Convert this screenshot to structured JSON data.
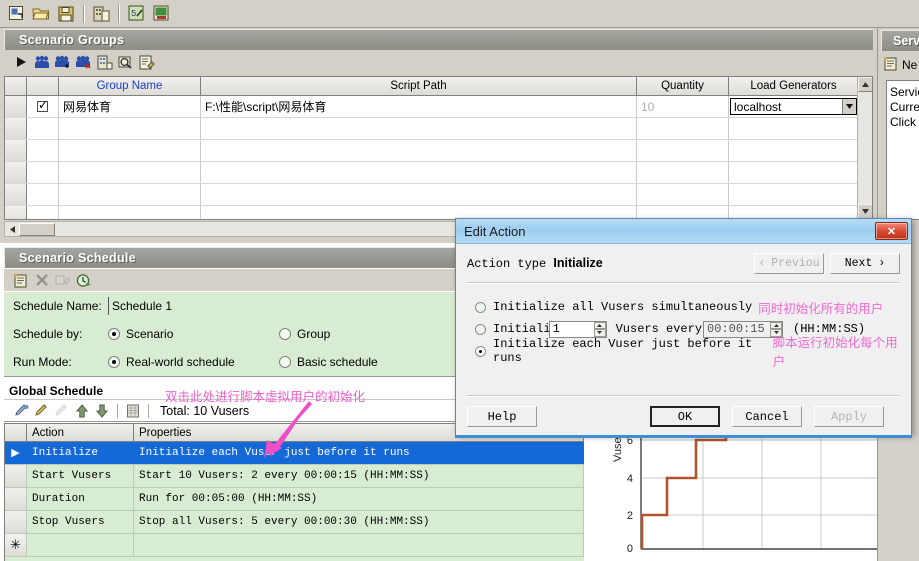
{
  "toolbar": {
    "buttons": [
      {
        "name": "open-scenario-icon",
        "glyph": "⬚"
      },
      {
        "name": "open-folder-icon",
        "glyph": "📂"
      },
      {
        "name": "save-icon",
        "glyph": "💾"
      },
      {
        "name": "report-icon",
        "glyph": "📊"
      },
      {
        "name": "run-script-icon",
        "glyph": "📝"
      },
      {
        "name": "results-icon",
        "glyph": "🖼"
      }
    ]
  },
  "scenario_groups": {
    "title": "Scenario Groups",
    "toolbar": [
      {
        "name": "start-scenario-icon",
        "glyph": "▶"
      },
      {
        "name": "vuser-group-icon",
        "glyph": "👥"
      },
      {
        "name": "add-vusers-icon",
        "glyph": "👥"
      },
      {
        "name": "remove-vusers-icon",
        "glyph": "👥"
      },
      {
        "name": "group-details-icon",
        "glyph": "🏢"
      },
      {
        "name": "view-script-icon",
        "glyph": "🔍"
      },
      {
        "name": "edit-script-icon",
        "glyph": "📄"
      }
    ],
    "columns": [
      "",
      "",
      "Group Name",
      "Script Path",
      "Quantity",
      "Load Generators"
    ],
    "rows": [
      {
        "selected": true,
        "enabled": true,
        "group_name": "网易体育",
        "script_path": "F:\\性能\\script\\网易体育",
        "quantity": "10",
        "load_generator": "localhost"
      }
    ]
  },
  "scenario_schedule": {
    "title": "Scenario Schedule",
    "toolbar": [
      {
        "name": "new-schedule-icon",
        "glyph": "📜"
      },
      {
        "name": "delete-schedule-icon",
        "glyph": "✕"
      },
      {
        "name": "rename-schedule-icon",
        "glyph": "✎"
      },
      {
        "name": "schedule-clock-icon",
        "glyph": "🕑"
      }
    ],
    "schedule_name_label": "Schedule Name:",
    "schedule_name_value": "Schedule 1",
    "schedule_by_label": "Schedule by:",
    "schedule_by_options": [
      {
        "label": "Scenario",
        "selected": true
      },
      {
        "label": "Group",
        "selected": false
      }
    ],
    "run_mode_label": "Run Mode:",
    "run_mode_options": [
      {
        "label": "Real-world schedule",
        "selected": true
      },
      {
        "label": "Basic schedule",
        "selected": false
      }
    ]
  },
  "global_schedule": {
    "title": "Global Schedule",
    "toolbar": [
      {
        "name": "add-action-icon",
        "glyph": "✏"
      },
      {
        "name": "edit-action-icon",
        "glyph": "✏"
      },
      {
        "name": "delete-action-icon",
        "glyph": "✏"
      },
      {
        "name": "move-up-icon",
        "glyph": "⬆"
      },
      {
        "name": "move-down-icon",
        "glyph": "⬇"
      },
      {
        "name": "grid-view-icon",
        "glyph": "☰"
      }
    ],
    "total_label": "Total: 10 Vusers",
    "columns": [
      "",
      "Action",
      "Properties"
    ],
    "rows": [
      {
        "selected": true,
        "marker": "▶",
        "action": "Initialize",
        "properties": "Initialize each Vuser just before it runs"
      },
      {
        "selected": false,
        "marker": "",
        "action": "Start  Vusers",
        "properties": "Start 10 Vusers: 2 every 00:00:15 (HH:MM:SS)"
      },
      {
        "selected": false,
        "marker": "",
        "action": "Duration",
        "properties": "Run for 00:05:00 (HH:MM:SS)"
      },
      {
        "selected": false,
        "marker": "",
        "action": "Stop Vusers",
        "properties": "Stop all Vusers: 5 every 00:00:30 (HH:MM:SS)"
      },
      {
        "selected": false,
        "marker": "✳",
        "action": "",
        "properties": ""
      }
    ]
  },
  "right_panel": {
    "title": "Serv",
    "new_label": "Ne",
    "lines": [
      "Servic",
      "Curre",
      "Click"
    ]
  },
  "edit_action_dialog": {
    "title": "Edit Action",
    "close_glyph": "✕",
    "action_type_label": "Action type",
    "action_type_value": "Initialize",
    "previous_label": "Previou",
    "previous_chevron": "‹",
    "next_label": "Next",
    "next_chevron": "›",
    "options": [
      {
        "id": "init-all-simultaneously",
        "selected": false,
        "label": "Initialize all Vusers simultaneously",
        "annotation": "同时初始化所有的用户"
      },
      {
        "id": "init-batch",
        "selected": false,
        "label_prefix": "Initiali",
        "count_value": "1",
        "label_middle": "Vusers every",
        "interval_value": "00:00:15",
        "format_hint": "(HH:MM:SS)"
      },
      {
        "id": "init-each-before-run",
        "selected": true,
        "label": "Initialize each Vuser just before it runs",
        "annotation": "脚本运行初始化每个用户"
      }
    ],
    "buttons": {
      "help": "Help",
      "ok": "OK",
      "cancel": "Cancel",
      "apply": "Apply"
    }
  },
  "annotations": [
    {
      "name": "double-click-hint",
      "text": "双击此处进行脚本虚拟用户的初始化",
      "color": "#ef5fc8"
    }
  ],
  "chart_data": {
    "type": "line",
    "title": "",
    "xlabel": "",
    "ylabel": "Vuse",
    "ylim": [
      0,
      7
    ],
    "yticks": [
      0,
      2,
      4,
      6
    ],
    "ytick_labels": [
      "0",
      "2",
      "4",
      "6"
    ],
    "grid": true,
    "legend": "none",
    "series": [
      {
        "name": "Vusers",
        "color": "#b0532c",
        "step": true,
        "x": [
          0,
          0,
          10,
          10,
          22,
          22,
          33,
          33,
          46,
          46
        ],
        "y": [
          0,
          2,
          2,
          4,
          4,
          6,
          6,
          6,
          6,
          7
        ]
      }
    ]
  },
  "colors": {
    "accent_blue": "#1569d6",
    "annotation_pink": "#ef5fc8",
    "panel_gray": "#d4d0c8",
    "schedule_green": "#d8ecd3",
    "chart_line": "#b0532c",
    "header_link": "#1a3fd0"
  }
}
